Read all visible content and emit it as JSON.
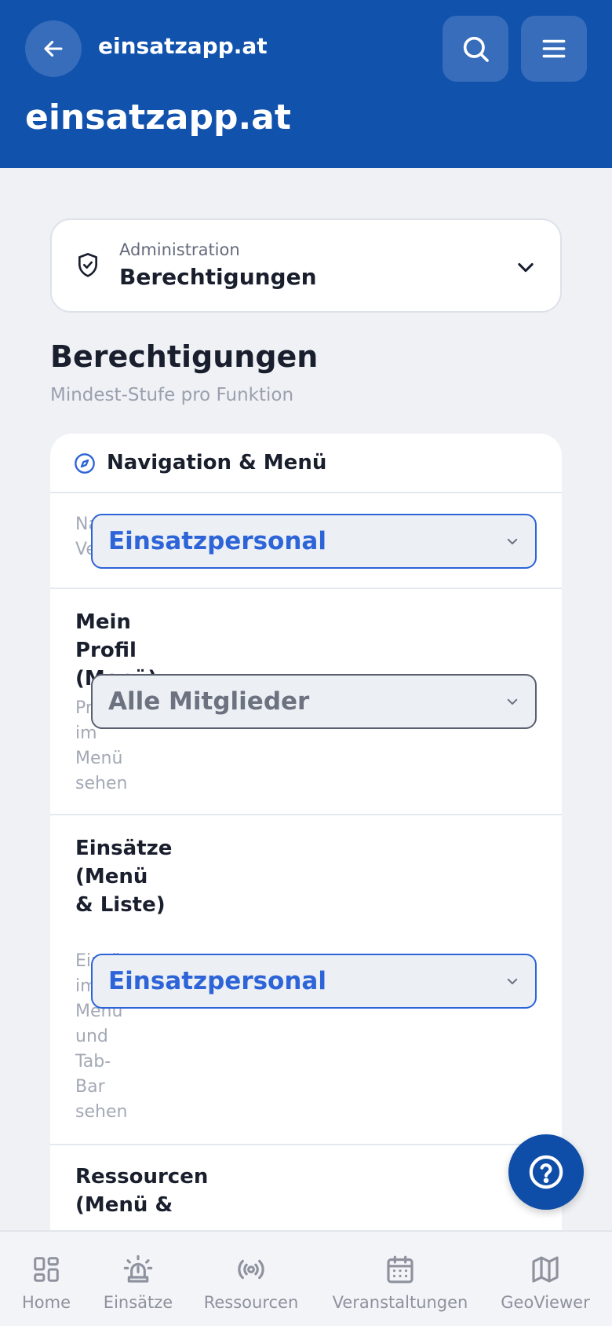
{
  "header": {
    "host_small": "einsatzapp.at",
    "host_big": "einsatzapp.at"
  },
  "breadcrumb": {
    "section": "Administration",
    "page": "Berechtigungen"
  },
  "page": {
    "title": "Berechtigungen",
    "subtitle": "Mindest-Stufe pro Funktion"
  },
  "panel": {
    "title": "Navigation & Menü",
    "rows": [
      {
        "name": "Na",
        "desc": "Ve",
        "level": "Einsatzpersonal"
      },
      {
        "name": "Mein Profil (Menü)",
        "desc": "Profil im Menü sehen",
        "level": "Alle Mitglieder"
      },
      {
        "name": "Einsätze (Menü & Liste)",
        "desc": "Einsätze im Menü und Tab-Bar sehen",
        "level": "Einsatzpersonal"
      },
      {
        "name": "Ressourcen (Menü &",
        "desc": "",
        "level": ""
      }
    ]
  },
  "tabs": [
    {
      "label": "Home",
      "icon": "grid-icon"
    },
    {
      "label": "Einsätze",
      "icon": "siren-icon"
    },
    {
      "label": "Ressourcen",
      "icon": "radio-icon"
    },
    {
      "label": "Veranstaltungen",
      "icon": "calendar-icon"
    },
    {
      "label": "GeoViewer",
      "icon": "map-icon"
    }
  ],
  "colors": {
    "brand": "#1152ad",
    "accent": "#2d64d8",
    "background": "#eff1f5"
  }
}
